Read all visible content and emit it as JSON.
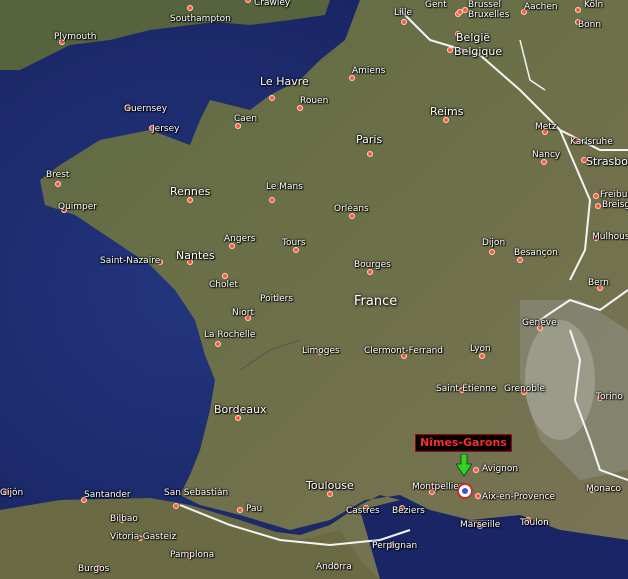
{
  "map": {
    "country_label": "France",
    "marker": {
      "label": "Nîmes-Garons",
      "accent": "#ff2a2a",
      "arrow_color": "#38d12a"
    },
    "cities": [
      {
        "name": "Southampton"
      },
      {
        "name": "Crawley"
      },
      {
        "name": "Plymouth"
      },
      {
        "name": "Lille"
      },
      {
        "name": "Gent"
      },
      {
        "name": "Brussel"
      },
      {
        "name": "Bruxelles"
      },
      {
        "name": "België"
      },
      {
        "name": "Belgique"
      },
      {
        "name": "Aachen"
      },
      {
        "name": "Köln"
      },
      {
        "name": "Bonn"
      },
      {
        "name": "Amiens"
      },
      {
        "name": "Le Havre"
      },
      {
        "name": "Rouen"
      },
      {
        "name": "Guernsey"
      },
      {
        "name": "Jersey"
      },
      {
        "name": "Caen"
      },
      {
        "name": "Paris"
      },
      {
        "name": "Reims"
      },
      {
        "name": "Metz"
      },
      {
        "name": "Karlsruhe"
      },
      {
        "name": "Nancy"
      },
      {
        "name": "Strasbourg"
      },
      {
        "name": "Brest"
      },
      {
        "name": "Quimper"
      },
      {
        "name": "Rennes"
      },
      {
        "name": "Le Mans"
      },
      {
        "name": "Orléans"
      },
      {
        "name": "Freiburg"
      },
      {
        "name": "Breisgau"
      },
      {
        "name": "Angers"
      },
      {
        "name": "Tours"
      },
      {
        "name": "Dijon"
      },
      {
        "name": "Mulhouse"
      },
      {
        "name": "Besançon"
      },
      {
        "name": "Saint-Nazaire"
      },
      {
        "name": "Nantes"
      },
      {
        "name": "Cholet"
      },
      {
        "name": "Bourges"
      },
      {
        "name": "Bern"
      },
      {
        "name": "Poitiers"
      },
      {
        "name": "Niort"
      },
      {
        "name": "Genève"
      },
      {
        "name": "La Rochelle"
      },
      {
        "name": "Limoges"
      },
      {
        "name": "Clermont-Ferrand"
      },
      {
        "name": "Lyon"
      },
      {
        "name": "Saint-Étienne"
      },
      {
        "name": "Grenoble"
      },
      {
        "name": "Torino"
      },
      {
        "name": "Bordeaux"
      },
      {
        "name": "Avignon"
      },
      {
        "name": "Toulouse"
      },
      {
        "name": "Montpellier"
      },
      {
        "name": "Aix-en-Provence"
      },
      {
        "name": "Monaco"
      },
      {
        "name": "Bilbao"
      },
      {
        "name": "Santander"
      },
      {
        "name": "San Sebastián"
      },
      {
        "name": "Pau"
      },
      {
        "name": "Castres"
      },
      {
        "name": "Béziers"
      },
      {
        "name": "Marseille"
      },
      {
        "name": "Toulon"
      },
      {
        "name": "Vitoria-Gasteiz"
      },
      {
        "name": "Pamplona"
      },
      {
        "name": "Perpignan"
      },
      {
        "name": "Burgos"
      },
      {
        "name": "Andorra"
      },
      {
        "name": "Gijón"
      }
    ]
  }
}
